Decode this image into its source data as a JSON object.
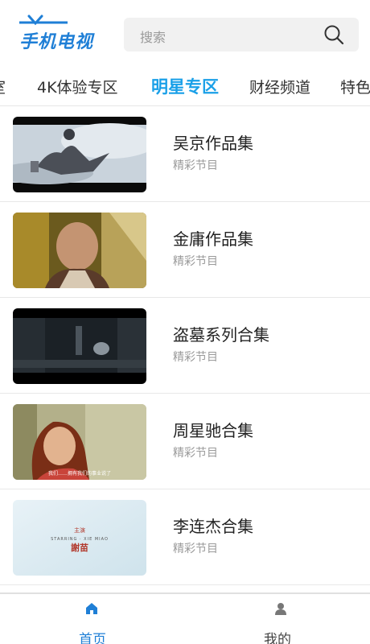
{
  "header": {
    "logo_text": "手机电视",
    "search_placeholder": "搜索"
  },
  "tabs": [
    {
      "label": "室"
    },
    {
      "label": "4K体验专区"
    },
    {
      "label": "明星专区",
      "active": true
    },
    {
      "label": "财经频道"
    },
    {
      "label": "特色"
    }
  ],
  "items": [
    {
      "title": "吴京作品集",
      "subtitle": "精彩节目"
    },
    {
      "title": "金庸作品集",
      "subtitle": "精彩节目"
    },
    {
      "title": "盗墓系列合集",
      "subtitle": "精彩节目"
    },
    {
      "title": "周星驰合集",
      "subtitle": "精彩节目"
    },
    {
      "title": "李连杰合集",
      "subtitle": "精彩节目"
    }
  ],
  "thumb_captions": {
    "item4_subtitle": "我们……拥有我们的事业说了",
    "item5_credit_small": "主演",
    "item5_credit_line": "STARRING · XIE MIAO",
    "item5_credit_name": "謝苗"
  },
  "bottom_nav": [
    {
      "label": "首页",
      "icon": "home-icon",
      "active": true
    },
    {
      "label": "我的",
      "icon": "user-icon",
      "active": false
    }
  ],
  "colors": {
    "accent": "#1aa0e8",
    "brand": "#1f7fd6"
  }
}
